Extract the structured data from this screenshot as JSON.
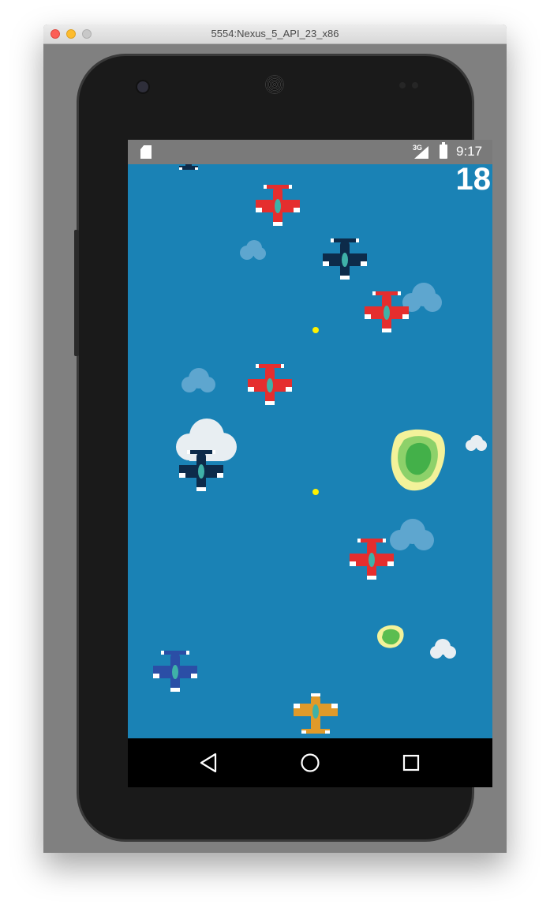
{
  "window": {
    "title": "5554:Nexus_5_API_23_x86"
  },
  "status_bar": {
    "network_type": "3G",
    "time": "9:17",
    "icons": [
      "sd-card-icon",
      "signal-icon",
      "battery-icon"
    ]
  },
  "game": {
    "score": "18",
    "sprites": [
      "red-plane",
      "dark-navy-plane",
      "blue-plane",
      "orange-player-plane",
      "cloud",
      "island",
      "bullet"
    ]
  },
  "nav_bar": {
    "buttons": [
      "back-icon",
      "home-icon",
      "recents-icon"
    ]
  },
  "colors": {
    "sea": "#1a82b5",
    "status_bar": "#7a7a7a",
    "enemy_red": "#e52e2e",
    "enemy_navy": "#0d2b4a",
    "enemy_blue": "#2b4ea6",
    "player_orange": "#e09a2a",
    "bullet": "#fff200"
  }
}
